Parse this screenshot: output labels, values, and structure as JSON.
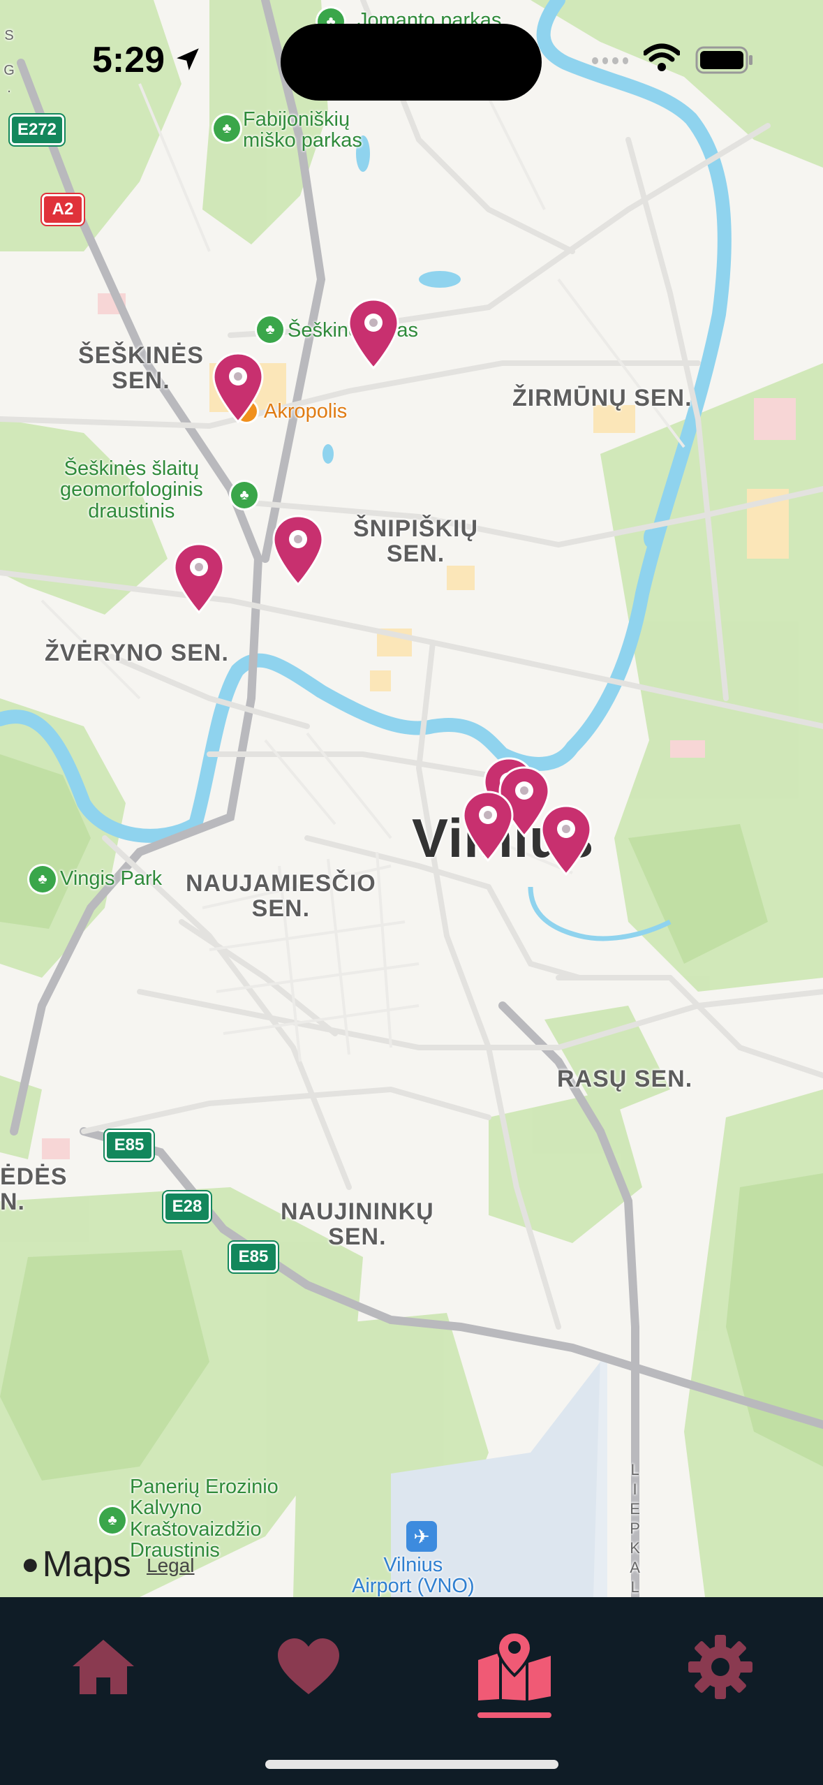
{
  "status_bar": {
    "time": "5:29"
  },
  "map": {
    "districts": [
      "ŠEŠKINĖS\nSEN.",
      "ŽIRMŪNŲ SEN.",
      "ŠNIPIŠKIŲ\nSEN.",
      "ŽVĖRYNO SEN.",
      "NAUJAMIESČIO\nSEN.",
      "RASŲ SEN.",
      "NAUJININKŲ\nSEN.",
      "ĖDĖS\nN."
    ],
    "city": "Vilnius",
    "parks": {
      "top": "Jomanto parkas",
      "fabijoniskiu": "Fabijoniškių\nmiško parkas",
      "seskines_ozas": "Šeškinės ozas",
      "seskines_slaitu": "Šeškinės šlaitų\ngeomorfologinis\ndraustinis",
      "vingis": "Vingis Park",
      "paneriu": "Panerių Erozinio\nKalvyno\nKraštovaizdžio\nDraustinis"
    },
    "poi": {
      "akropolis": "Akropolis"
    },
    "airport": "Vilnius\nAirport (VNO)",
    "street": "LIEPKALNIO G.",
    "edge_label": "S G.",
    "road_shields": [
      "E272",
      "A2",
      "E85",
      "E28",
      "E85"
    ],
    "maps_brand": "Maps",
    "legal": "Legal",
    "pin_color": "#c8306f"
  },
  "tab_bar": {
    "tabs": [
      {
        "name": "home",
        "active": false
      },
      {
        "name": "favorites",
        "active": false
      },
      {
        "name": "map",
        "active": true
      },
      {
        "name": "settings",
        "active": false
      }
    ],
    "active_color": "#f05a75",
    "inactive_color": "#8a3a50"
  }
}
